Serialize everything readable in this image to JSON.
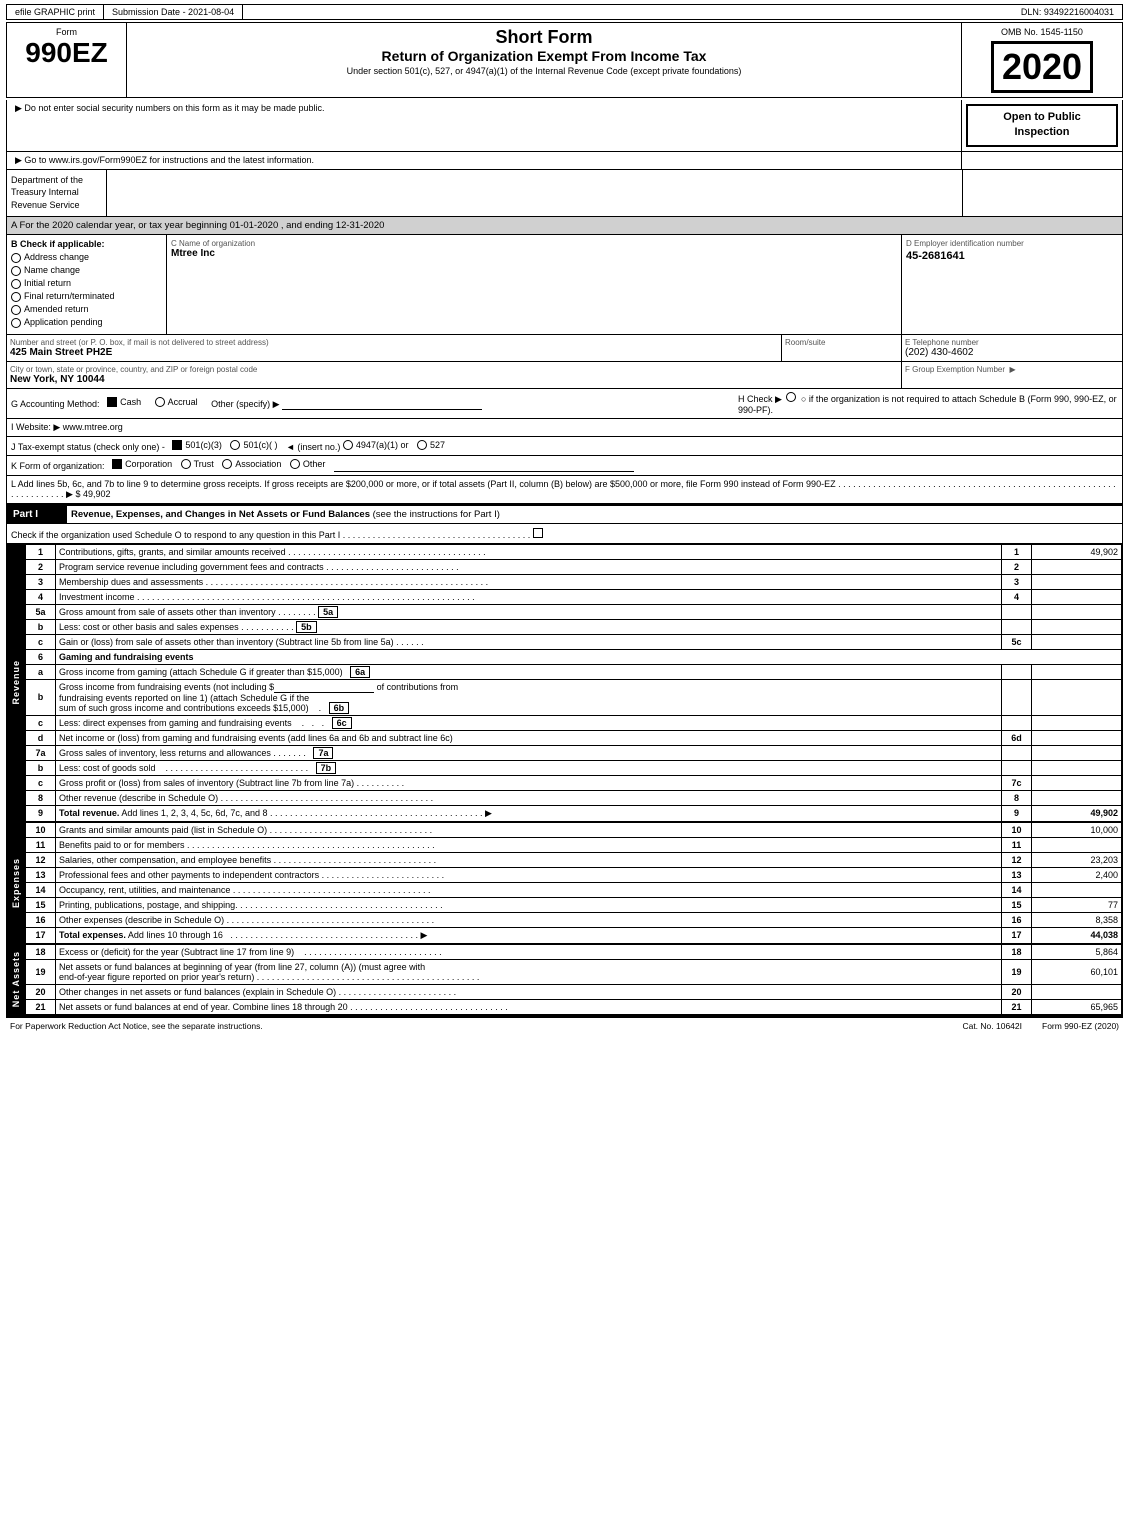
{
  "topbar": {
    "item1": "efile GRAPHIC print",
    "item2": "Submission Date - 2021-08-04",
    "item3": "DLN: 93492216004031"
  },
  "header": {
    "form_label": "Form",
    "form_number": "990EZ",
    "title1": "Short Form",
    "title2": "Return of Organization Exempt From Income Tax",
    "subtitle": "Under section 501(c), 527, or 4947(a)(1) of the Internal Revenue Code (except private foundations)",
    "notice1": "▶ Do not enter social security numbers on this form as it may be made public.",
    "notice2": "▶ Go to www.irs.gov/Form990EZ for instructions and the latest information.",
    "omb": "OMB No. 1545-1150",
    "year": "2020",
    "open_inspection": "Open to Public Inspection",
    "dept": "Department of the Treasury Internal Revenue Service"
  },
  "section_a": {
    "text": "A  For the 2020 calendar year, or tax year beginning 01-01-2020 , and ending 12-31-2020"
  },
  "check_b": {
    "label": "B  Check if applicable:",
    "items": [
      {
        "label": "Address change",
        "checked": false
      },
      {
        "label": "Name change",
        "checked": false
      },
      {
        "label": "Initial return",
        "checked": false
      },
      {
        "label": "Final return/terminated",
        "checked": false
      },
      {
        "label": "Amended return",
        "checked": false
      },
      {
        "label": "Application pending",
        "checked": false
      }
    ]
  },
  "org": {
    "name_label": "C Name of organization",
    "name_value": "Mtree Inc",
    "address_label": "Number and street (or P. O. box, if mail is not delivered to street address)",
    "address_value": "425 Main Street PH2E",
    "room_label": "Room/suite",
    "room_value": "",
    "city_label": "City or town, state or province, country, and ZIP or foreign postal code",
    "city_value": "New York, NY  10044",
    "ein_label": "D Employer identification number",
    "ein_value": "45-2681641",
    "phone_label": "E Telephone number",
    "phone_value": "(202) 430-4602",
    "group_label": "F Group Exemption Number",
    "group_arrow": "▶"
  },
  "accounting": {
    "label": "G Accounting Method:",
    "cash_label": "Cash",
    "cash_checked": true,
    "accrual_label": "Accrual",
    "accrual_checked": false,
    "other_label": "Other (specify) ▶",
    "h_text": "H  Check ▶",
    "h_circle_label": "○ if the organization is not required to attach Schedule B (Form 990, 990-EZ, or 990-PF)."
  },
  "website": {
    "label": "I Website: ▶",
    "value": "www.mtree.org"
  },
  "tax_status": {
    "label": "J Tax-exempt status (check only one) -",
    "options": [
      {
        "label": "501(c)(3)",
        "checked": true
      },
      {
        "label": "501(c)(  )",
        "checked": false
      },
      {
        "label": "(insert no.)"
      },
      {
        "label": "4947(a)(1) or",
        "checked": false
      },
      {
        "label": "527",
        "checked": false
      }
    ]
  },
  "k_form": {
    "label": "K Form of organization:",
    "options": [
      {
        "label": "Corporation",
        "checked": true
      },
      {
        "label": "Trust",
        "checked": false
      },
      {
        "label": "Association",
        "checked": false
      },
      {
        "label": "Other",
        "checked": false
      }
    ]
  },
  "l_add": {
    "text": "L Add lines 5b, 6c, and 7b to line 9 to determine gross receipts. If gross receipts are $200,000 or more, or if total assets (Part II, column (B) below) are $500,000 or more, file Form 990 instead of Form 990-EZ",
    "dots": ". . . . . . . . . . . . . . . . . . . . . . . . . . . . . . . . . . . . . . . . . . . . . . . . . . . . . . . . . . . . . . . . . . . .",
    "arrow": "▶",
    "value": "$ 49,902"
  },
  "part1": {
    "header": "Part I    Revenue, Expenses, and Changes in Net Assets or Fund Balances",
    "header_sub": "(see the instructions for Part I)",
    "check_text": "Check if the organization used Schedule O to respond to any question in this Part I",
    "check_dots": ". . . . . . . . . . . . . . . . . . . . . . . . . . . . . . . .",
    "lines": [
      {
        "num": "1",
        "desc": "Contributions, gifts, grants, and similar amounts received",
        "dots": ". . . . . . . . . . . . . . . . . . . . . . . . . . . . . . . . . . . . . . . .",
        "ref": "1",
        "amount": "49,902"
      },
      {
        "num": "2",
        "desc": "Program service revenue including government fees and contracts",
        "dots": ". . . . . . . . . . . . . . . . . . . . . . . . . . .",
        "ref": "2",
        "amount": ""
      },
      {
        "num": "3",
        "desc": "Membership dues and assessments",
        "dots": ". . . . . . . . . . . . . . . . . . . . . . . . . . . . . . . . . . . . . . . . . . . . . . . . . . . . . . . . .",
        "ref": "3",
        "amount": ""
      },
      {
        "num": "4",
        "desc": "Investment income",
        "dots": ". . . . . . . . . . . . . . . . . . . . . . . . . . . . . . . . . . . . . . . . . . . . . . . . . . . . . . . . . . . . . . . . . . . .",
        "ref": "4",
        "amount": ""
      },
      {
        "num": "5a",
        "desc": "Gross amount from sale of assets other than inventory",
        "dots": ". . . . . . . .",
        "ref": "5a",
        "amount": "",
        "has_sub": true
      },
      {
        "num": "b",
        "desc": "Less: cost or other basis and sales expenses",
        "dots": ". . . . . . . . . . . .",
        "ref": "5b",
        "amount": "",
        "has_sub": true
      },
      {
        "num": "c",
        "desc": "Gain or (loss) from sale of assets other than inventory (Subtract line 5b from line 5a)",
        "dots": ". . . . . .",
        "ref": "5c",
        "amount": ""
      },
      {
        "num": "6",
        "desc": "Gaming and fundraising events",
        "dots": "",
        "ref": "",
        "amount": "",
        "header_row": true
      },
      {
        "num": "a",
        "desc": "Gross income from gaming (attach Schedule G if greater than $15,000)",
        "dots": "",
        "ref": "6a",
        "amount": "",
        "has_sub": true
      },
      {
        "num": "b",
        "desc_multi": true,
        "desc_lines": [
          "Gross income from fundraising events (not including $",
          "of contributions from",
          "fundraising events reported on line 1) (attach Schedule G if the",
          "sum of such gross income and contributions exceeds $15,000)"
        ],
        "dots": ".",
        "ref": "6b",
        "amount": "",
        "has_sub": true
      },
      {
        "num": "c",
        "desc": "Less: direct expenses from gaming and fundraising events",
        "dots": ". . .",
        "ref": "6c",
        "amount": "",
        "has_sub": true
      },
      {
        "num": "d",
        "desc": "Net income or (loss) from gaming and fundraising events (add lines 6a and 6b and subtract line 6c)",
        "dots": "",
        "ref": "6d",
        "amount": ""
      },
      {
        "num": "7a",
        "desc": "Gross sales of inventory, less returns and allowances",
        "dots": ". . . . . . .",
        "ref": "7a",
        "amount": "",
        "has_sub": true
      },
      {
        "num": "b",
        "desc": "Less: cost of goods sold",
        "dots": ". . . . . . . . . . . . . . . . . . . . . . . . . . . . .",
        "ref": "7b",
        "amount": "",
        "has_sub": true
      },
      {
        "num": "c",
        "desc": "Gross profit or (loss) from sales of inventory (Subtract line 7b from line 7a)",
        "dots": ". . . . . . . . . .",
        "ref": "7c",
        "amount": ""
      },
      {
        "num": "8",
        "desc": "Other revenue (describe in Schedule O)",
        "dots": ". . . . . . . . . . . . . . . . . . . . . . . . . . . . . . . . . . . . . . . . . . .",
        "ref": "8",
        "amount": ""
      },
      {
        "num": "9",
        "desc": "Total revenue. Add lines 1, 2, 3, 4, 5c, 6d, 7c, and 8",
        "dots": ". . . . . . . . . . . . . . . . . . . . . . . . . . . . . . . . . . . . . . . . . . . .",
        "arrow": "▶",
        "ref": "9",
        "amount": "49,902",
        "bold": true
      }
    ],
    "expenses_lines": [
      {
        "num": "10",
        "desc": "Grants and similar amounts paid (list in Schedule O)",
        "dots": ". . . . . . . . . . . . . . . . . . . . . . . . . . . . . . . . .",
        "ref": "10",
        "amount": "10,000"
      },
      {
        "num": "11",
        "desc": "Benefits paid to or for members",
        "dots": ". . . . . . . . . . . . . . . . . . . . . . . . . . . . . . . . . . . . . . . . . . . . . . . . . .",
        "ref": "11",
        "amount": ""
      },
      {
        "num": "12",
        "desc": "Salaries, other compensation, and employee benefits",
        "dots": ". . . . . . . . . . . . . . . . . . . . . . . . . . . . . . . . .",
        "ref": "12",
        "amount": "23,203"
      },
      {
        "num": "13",
        "desc": "Professional fees and other payments to independent contractors",
        "dots": ". . . . . . . . . . . . . . . . . . . . . . . . . .",
        "ref": "13",
        "amount": "2,400"
      },
      {
        "num": "14",
        "desc": "Occupancy, rent, utilities, and maintenance",
        "dots": ". . . . . . . . . . . . . . . . . . . . . . . . . . . . . . . . . . . . . . . . .",
        "ref": "14",
        "amount": ""
      },
      {
        "num": "15",
        "desc": "Printing, publications, postage, and shipping",
        "dots": ". . . . . . . . . . . . . . . . . . . . . . . . . . . . . . . . . . . . . . . . . .",
        "ref": "15",
        "amount": "77"
      },
      {
        "num": "16",
        "desc": "Other expenses (describe in Schedule O)",
        "dots": ". . . . . . . . . . . . . . . . . . . . . . . . . . . . . . . . . . . . . . . . .",
        "ref": "16",
        "amount": "8,358"
      },
      {
        "num": "17",
        "desc": "Total expenses. Add lines 10 through 16",
        "dots": ". . . . . . . . . . . . . . . . . . . . . . . . . . . . . . . . . . . . . . .",
        "arrow": "▶",
        "ref": "17",
        "amount": "44,038",
        "bold": true
      }
    ],
    "netassets_lines": [
      {
        "num": "18",
        "desc": "Excess or (deficit) for the year (Subtract line 17 from line 9)",
        "dots": ". . . . . . . . . . . . . . . . . . . . . . . . . . . .",
        "ref": "18",
        "amount": "5,864"
      },
      {
        "num": "19",
        "desc_multi": true,
        "desc_lines": [
          "Net assets or fund balances at beginning of year (from line 27, column (A)) (must agree with",
          "end-of-year figure reported on prior year's return)"
        ],
        "dots": ". . . . . . . . . . . . . . . . . . . . . . . . . . . . . . . . . . . . . . . . . . . . .",
        "ref": "19",
        "amount": "60,101"
      },
      {
        "num": "20",
        "desc": "Other changes in net assets or fund balances (explain in Schedule O)",
        "dots": ". . . . . . . . . . . . . . . . . . . . . . . . . . . . . .",
        "ref": "20",
        "amount": ""
      },
      {
        "num": "21",
        "desc": "Net assets or fund balances at end of year. Combine lines 18 through 20",
        "dots": ". . . . . . . . . . . . . . . . . . . . . . . . . . . . . . . . .",
        "ref": "21",
        "amount": "65,965"
      }
    ]
  },
  "footer": {
    "left": "For Paperwork Reduction Act Notice, see the separate instructions.",
    "cat": "Cat. No. 10642I",
    "form": "Form 990-EZ (2020)"
  }
}
